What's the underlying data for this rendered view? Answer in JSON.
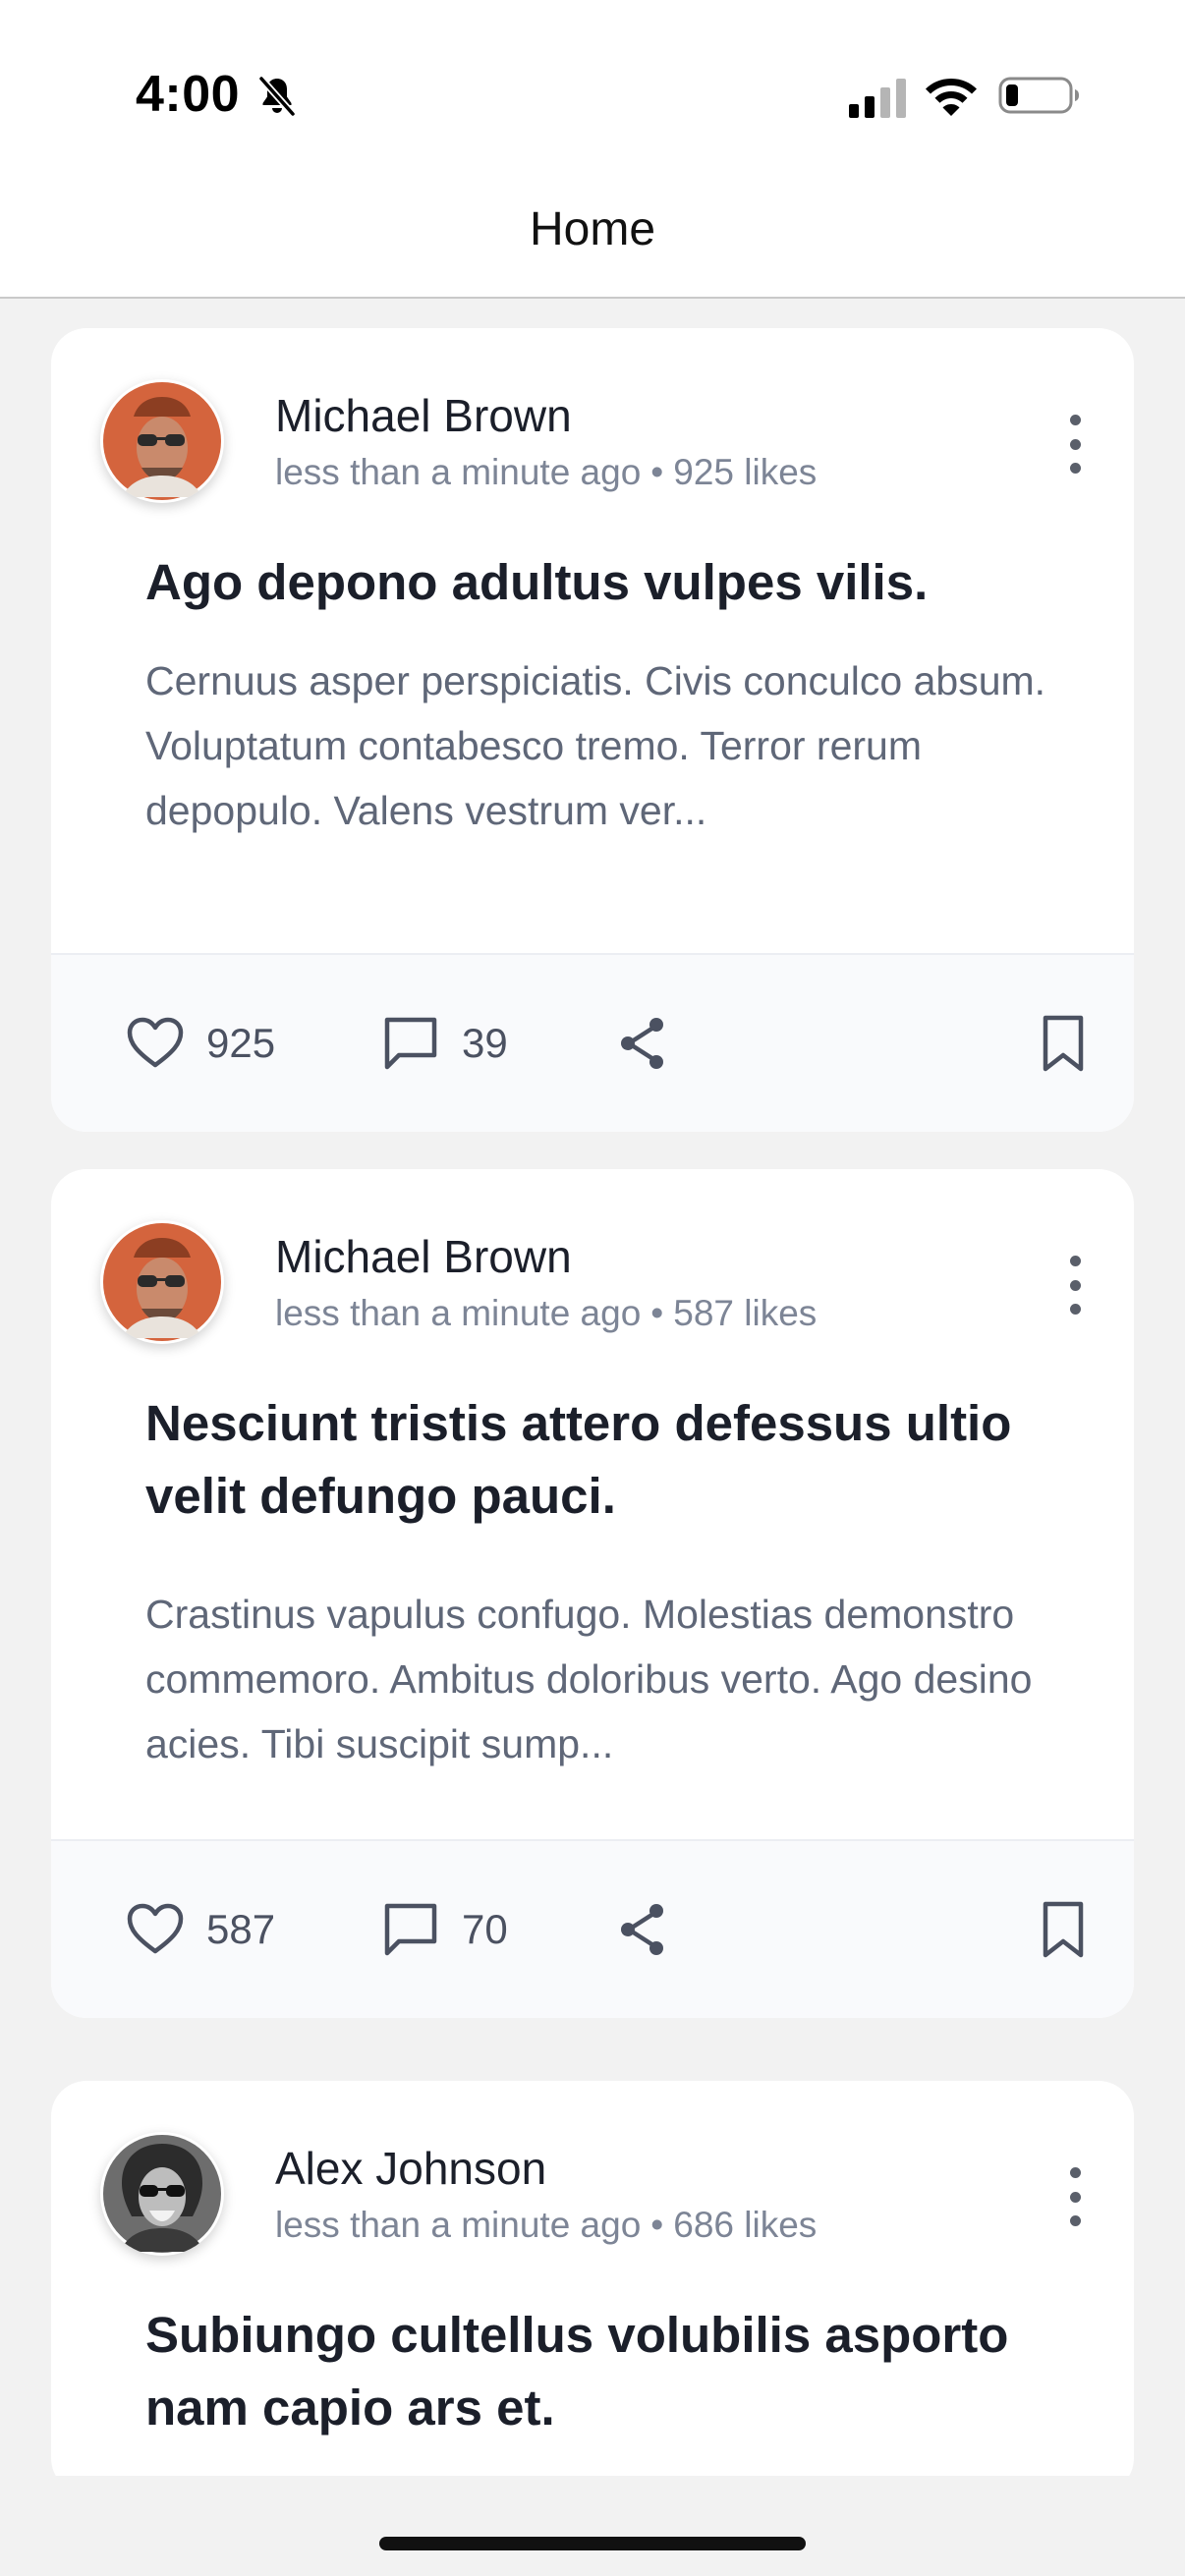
{
  "status_bar": {
    "time": "4:00",
    "icons": [
      "bell-slash-icon",
      "cellular-signal-icon",
      "wifi-icon",
      "battery-low-icon"
    ]
  },
  "header": {
    "title": "Home"
  },
  "posts": [
    {
      "author": "Michael Brown",
      "time_ago": "less than a minute ago",
      "likes_label": "925 likes",
      "title": "Ago depono adultus vulpes vilis.",
      "body": "Cernuus asper perspiciatis. Civis conculco absum. Voluptatum contabesco tremo. Terror rerum depopulo. Valens vestrum ver...",
      "like_count": "925",
      "comment_count": "39"
    },
    {
      "author": "Michael Brown",
      "time_ago": "less than a minute ago",
      "likes_label": "587 likes",
      "title": "Nesciunt tristis attero defessus ultio velit defungo pauci.",
      "body": "Crastinus vapulus confugo. Molestias demonstro commemoro. Ambitus doloribus verto. Ago desino acies. Tibi suscipit sump...",
      "like_count": "587",
      "comment_count": "70"
    },
    {
      "author": "Alex Johnson",
      "time_ago": "less than a minute ago",
      "likes_label": "686 likes",
      "title": "Subiungo cultellus volubilis asporto nam capio ars et."
    }
  ],
  "meta_separator": "•",
  "colors": {
    "background": "#f2f2f2",
    "card": "#ffffff",
    "text_primary": "#1b1f2a",
    "text_secondary": "#7d8596",
    "action_bar": "#f9fafc"
  }
}
